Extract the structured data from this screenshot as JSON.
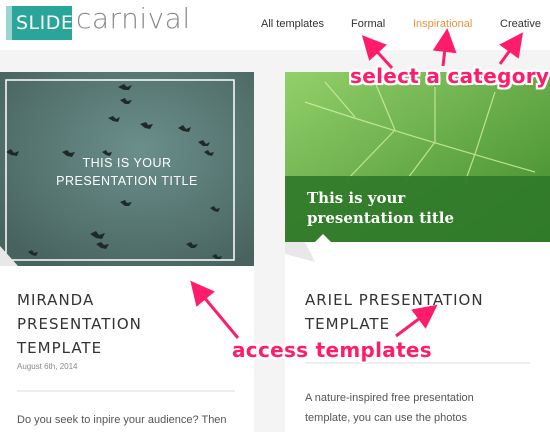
{
  "header": {
    "logo_slides": "SLIDES",
    "logo_carnival": "carnival",
    "nav": [
      "All templates",
      "Formal",
      "Inspirational",
      "Creative"
    ]
  },
  "cards": [
    {
      "thumb_title_line1": "THIS IS YOUR",
      "thumb_title_line2": "PRESENTATION TITLE",
      "title_line1": "MIRANDA",
      "title_line2": "PRESENTATION",
      "title_line3": "TEMPLATE",
      "date": "August 6th, 2014",
      "body": "Do you seek to inpire your audience? Then"
    },
    {
      "thumb_title_line1": "This is your",
      "thumb_title_line2": "presentation title",
      "title_line1": "ARIEL PRESENTATION",
      "title_line2": "TEMPLATE",
      "body_line1": "A nature-inspired free presentation",
      "body_line2": "template, you can use the photos"
    }
  ],
  "annotations": {
    "select_category": "select a category",
    "access_templates": "access templates"
  },
  "colors": {
    "brand": "#2aa59a",
    "active_nav": "#e8943a",
    "annotation": "#ff1d6b"
  }
}
